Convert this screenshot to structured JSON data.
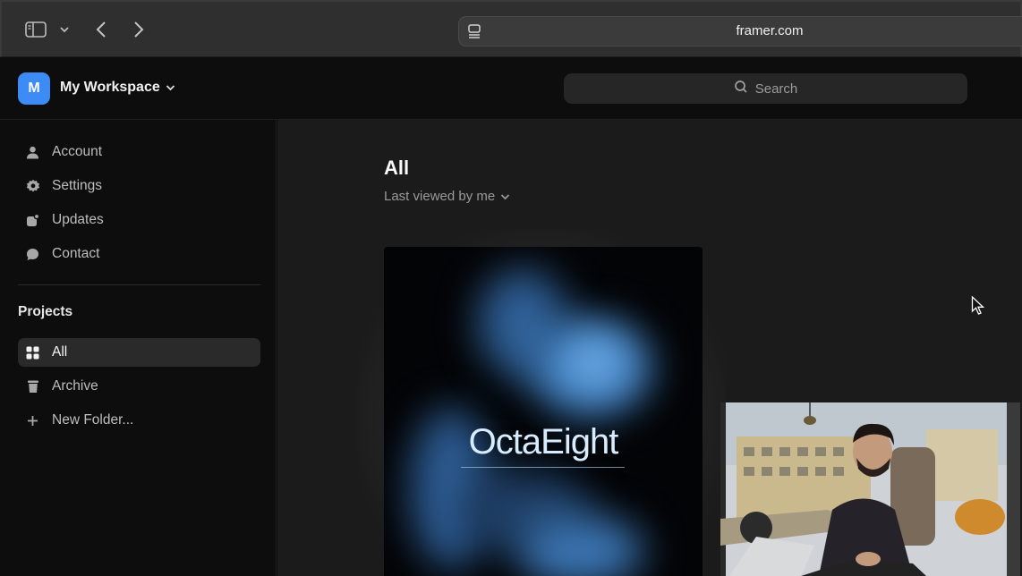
{
  "browser": {
    "url": "framer.com"
  },
  "header": {
    "workspace_initial": "M",
    "workspace_name": "My Workspace",
    "search_placeholder": "Search"
  },
  "sidebar": {
    "items": [
      {
        "label": "Account",
        "icon": "person-icon"
      },
      {
        "label": "Settings",
        "icon": "gear-icon"
      },
      {
        "label": "Updates",
        "icon": "updates-icon"
      },
      {
        "label": "Contact",
        "icon": "chat-bubble-icon"
      }
    ],
    "projects_title": "Projects",
    "projects": [
      {
        "label": "All",
        "icon": "grid-icon",
        "active": true
      },
      {
        "label": "Archive",
        "icon": "trash-icon",
        "active": false
      },
      {
        "label": "New Folder...",
        "icon": "plus-icon",
        "active": false
      }
    ]
  },
  "main": {
    "title": "All",
    "sort_label": "Last viewed by me",
    "cards": [
      {
        "title": "OctaEight"
      }
    ]
  },
  "colors": {
    "accent": "#3d8bf5",
    "background": "#1b1b1b",
    "sidebar": "#0d0d0d"
  }
}
